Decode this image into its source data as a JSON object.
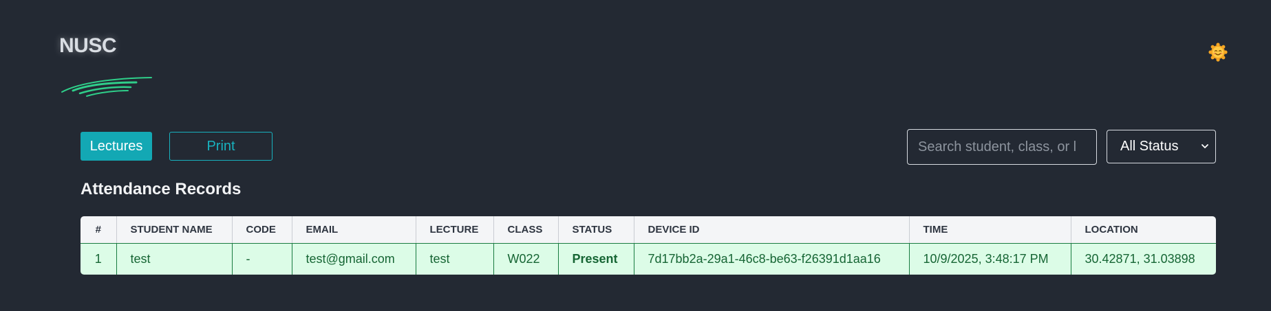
{
  "app": {
    "logo_text": "NUSC",
    "theme_toggle_icon": "sun-face-icon",
    "accent_color": "#13a8b4",
    "logo_stroke_color": "#2fcf8a",
    "background_color": "#232933"
  },
  "toolbar": {
    "lectures_label": "Lectures",
    "print_label": "Print",
    "search_placeholder": "Search student, class, or l",
    "search_value": "",
    "status_filter_selected": "All Status"
  },
  "page_title": "Attendance Records",
  "table": {
    "columns": [
      "#",
      "STUDENT NAME",
      "CODE",
      "EMAIL",
      "LECTURE",
      "CLASS",
      "STATUS",
      "DEVICE ID",
      "TIME",
      "LOCATION"
    ],
    "rows": [
      {
        "index": "1",
        "student_name": "test",
        "code": "-",
        "email": "test@gmail.com",
        "lecture": "test",
        "class": "W022",
        "status": "Present",
        "device_id": "7d17bb2a-29a1-46c8-be63-f26391d1aa16",
        "time": "10/9/2025, 3:48:17 PM",
        "location": "30.42871, 31.03898"
      }
    ],
    "row_status_color": "#166534",
    "row_background_color": "#dcfce7"
  }
}
